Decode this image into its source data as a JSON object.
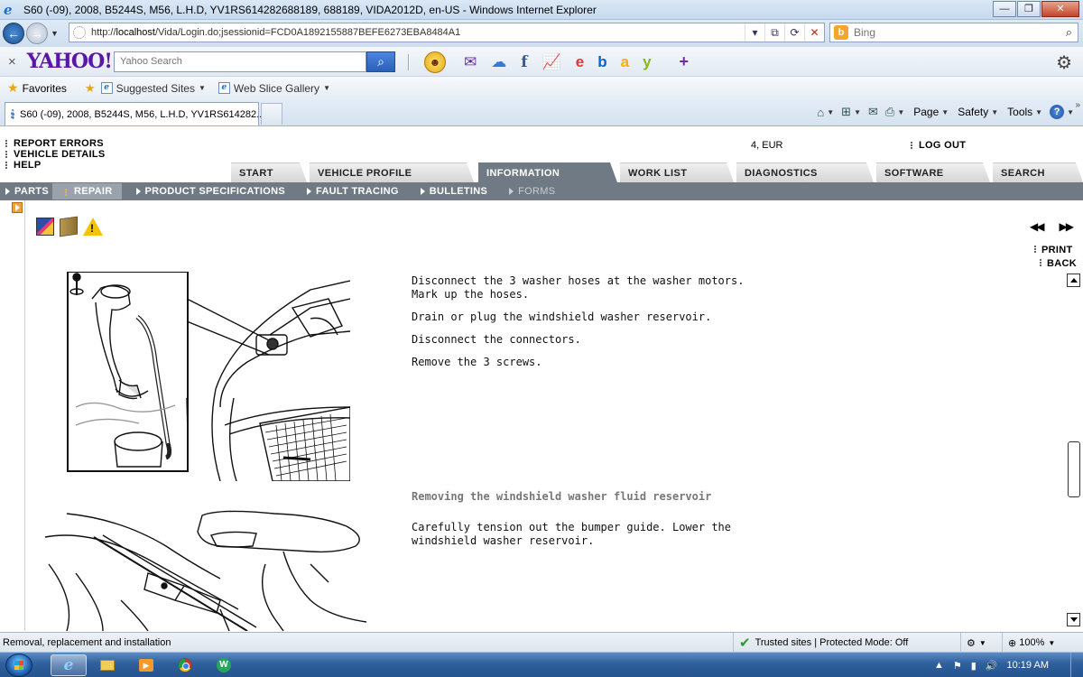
{
  "window": {
    "title": "S60 (-09), 2008, B5244S, M56, L.H.D, YV1RS614282688189, 688189, VIDA2012D, en-US - Windows Internet Explorer"
  },
  "address": {
    "url_prefix": "http://",
    "url_host": "localhost",
    "url_path": "/Vida/Login.do;jsessionid=FCD0A1892155887BEFE6273EBA8484A1",
    "search_placeholder": "Bing"
  },
  "yahoo_toolbar": {
    "logo": "YAHOO!",
    "search_placeholder": "Yahoo Search",
    "ebay": "ebay"
  },
  "favorites_bar": {
    "favorites_label": "Favorites",
    "items": [
      "Suggested Sites",
      "Web Slice Gallery"
    ]
  },
  "tab": {
    "title": "S60 (-09), 2008, B5244S, M56, L.H.D, YV1RS614282..."
  },
  "command_bar": {
    "page": "Page",
    "safety": "Safety",
    "tools": "Tools"
  },
  "vida": {
    "top_links": [
      "REPORT ERRORS",
      "VEHICLE DETAILS",
      "HELP"
    ],
    "currency": "4, EUR",
    "logout": "LOG OUT",
    "main_tabs": [
      "START",
      "VEHICLE PROFILE",
      "INFORMATION",
      "WORK LIST",
      "DIAGNOSTICS",
      "SOFTWARE",
      "SEARCH"
    ],
    "active_main_tab": "INFORMATION",
    "sub_nav": [
      "PARTS",
      "REPAIR",
      "PRODUCT SPECIFICATIONS",
      "FAULT TRACING",
      "BULLETINS",
      "FORMS"
    ],
    "active_sub_nav": "REPAIR",
    "pager": {
      "prev": "◀◀",
      "next": "▶▶"
    },
    "print": "PRINT",
    "back": "BACK",
    "steps": [
      {
        "lines": [
          "Disconnect the 3 washer hoses at the washer motors.",
          "Mark up the hoses."
        ]
      },
      {
        "lines": [
          "Drain or plug the windshield washer reservoir."
        ]
      },
      {
        "lines": [
          "Disconnect the connectors."
        ]
      },
      {
        "lines": [
          "Remove the 3 screws."
        ]
      }
    ],
    "section_heading": "Removing the windshield washer fluid reservoir",
    "section_steps": [
      {
        "lines": [
          "Carefully tension out the bumper guide. Lower the",
          "windshield washer reservoir."
        ]
      }
    ]
  },
  "status_bar": {
    "text": "Removal, replacement and installation",
    "zone": "Trusted sites | Protected Mode: Off",
    "zoom": "100%"
  },
  "taskbar": {
    "clock": "10:19 AM"
  }
}
